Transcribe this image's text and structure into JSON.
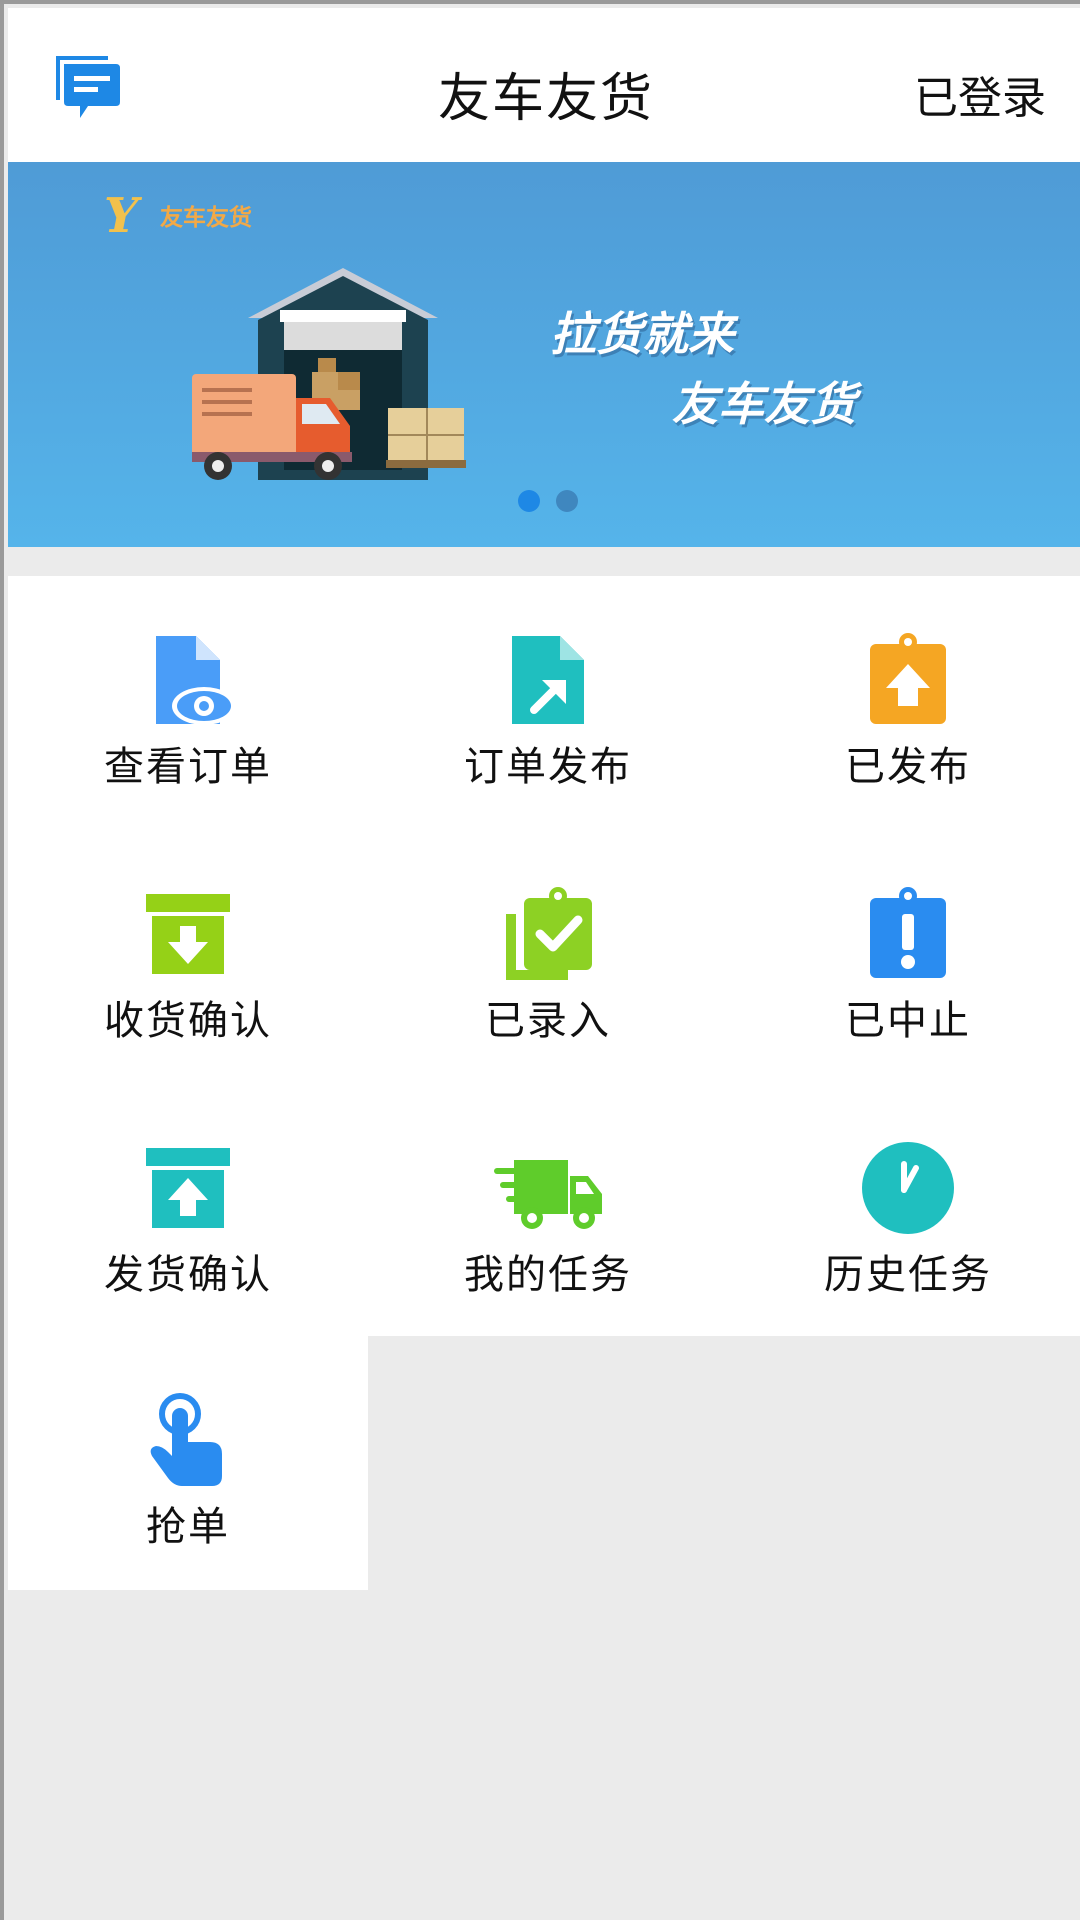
{
  "header": {
    "title": "友车友货",
    "login_status": "已登录",
    "message_icon": "message-icon",
    "accent_color": "#1e88e5"
  },
  "banner": {
    "logo_mark": "Y",
    "logo_text": "友车友货",
    "slogan_line1": "拉货就来",
    "slogan_line2": "友车友货",
    "slide_count": 2,
    "active_slide": 1
  },
  "menu": [
    {
      "label": "查看订单",
      "icon": "view-order-icon",
      "color": "#4a9df8"
    },
    {
      "label": "订单发布",
      "icon": "publish-order-icon",
      "color": "#1fbfbf"
    },
    {
      "label": "已发布",
      "icon": "published-icon",
      "color": "#f5a623"
    },
    {
      "label": "收货确认",
      "icon": "receive-confirm-icon",
      "color": "#95d117"
    },
    {
      "label": "已录入",
      "icon": "entered-icon",
      "color": "#8dd124"
    },
    {
      "label": "已中止",
      "icon": "stopped-icon",
      "color": "#2a8cf0"
    },
    {
      "label": "发货确认",
      "icon": "ship-confirm-icon",
      "color": "#1fbfbf"
    },
    {
      "label": "我的任务",
      "icon": "truck-icon",
      "color": "#5fcc2b"
    },
    {
      "label": "历史任务",
      "icon": "clock-icon",
      "color": "#1fbfbf"
    },
    {
      "label": "抢单",
      "icon": "tap-icon",
      "color": "#2a8cf0"
    }
  ]
}
